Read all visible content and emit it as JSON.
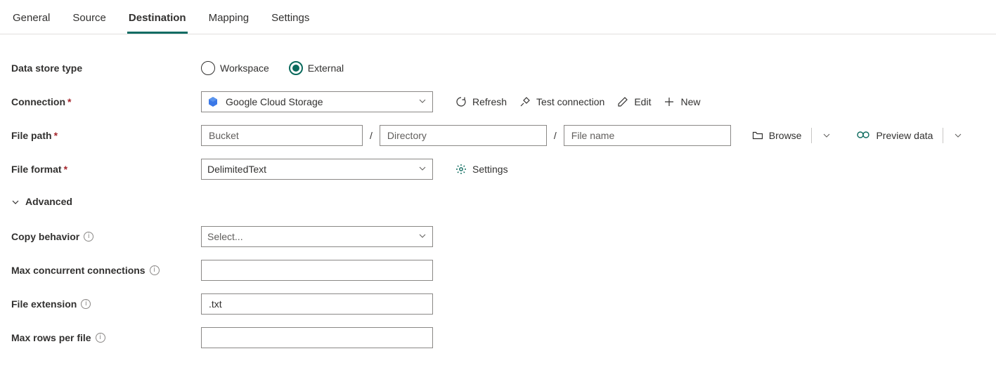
{
  "tabs": {
    "general": "General",
    "source": "Source",
    "destination": "Destination",
    "mapping": "Mapping",
    "settings": "Settings",
    "active": "destination"
  },
  "labels": {
    "dataStoreType": "Data store type",
    "connection": "Connection",
    "filePath": "File path",
    "fileFormat": "File format",
    "advanced": "Advanced",
    "copyBehavior": "Copy behavior",
    "maxConcurrent": "Max concurrent connections",
    "fileExtension": "File extension",
    "maxRowsPerFile": "Max rows per file"
  },
  "dataStoreType": {
    "workspace": "Workspace",
    "external": "External",
    "selected": "external"
  },
  "connection": {
    "value": "Google Cloud Storage",
    "refresh": "Refresh",
    "testConnection": "Test connection",
    "edit": "Edit",
    "new": "New"
  },
  "filePath": {
    "bucket_ph": "Bucket",
    "directory_ph": "Directory",
    "filename_ph": "File name",
    "browse": "Browse",
    "preview": "Preview data"
  },
  "fileFormat": {
    "value": "DelimitedText",
    "settings": "Settings"
  },
  "copyBehavior": {
    "placeholder": "Select..."
  },
  "fileExtension": {
    "value": ".txt"
  },
  "maxConcurrent": {
    "value": ""
  },
  "maxRows": {
    "value": ""
  }
}
